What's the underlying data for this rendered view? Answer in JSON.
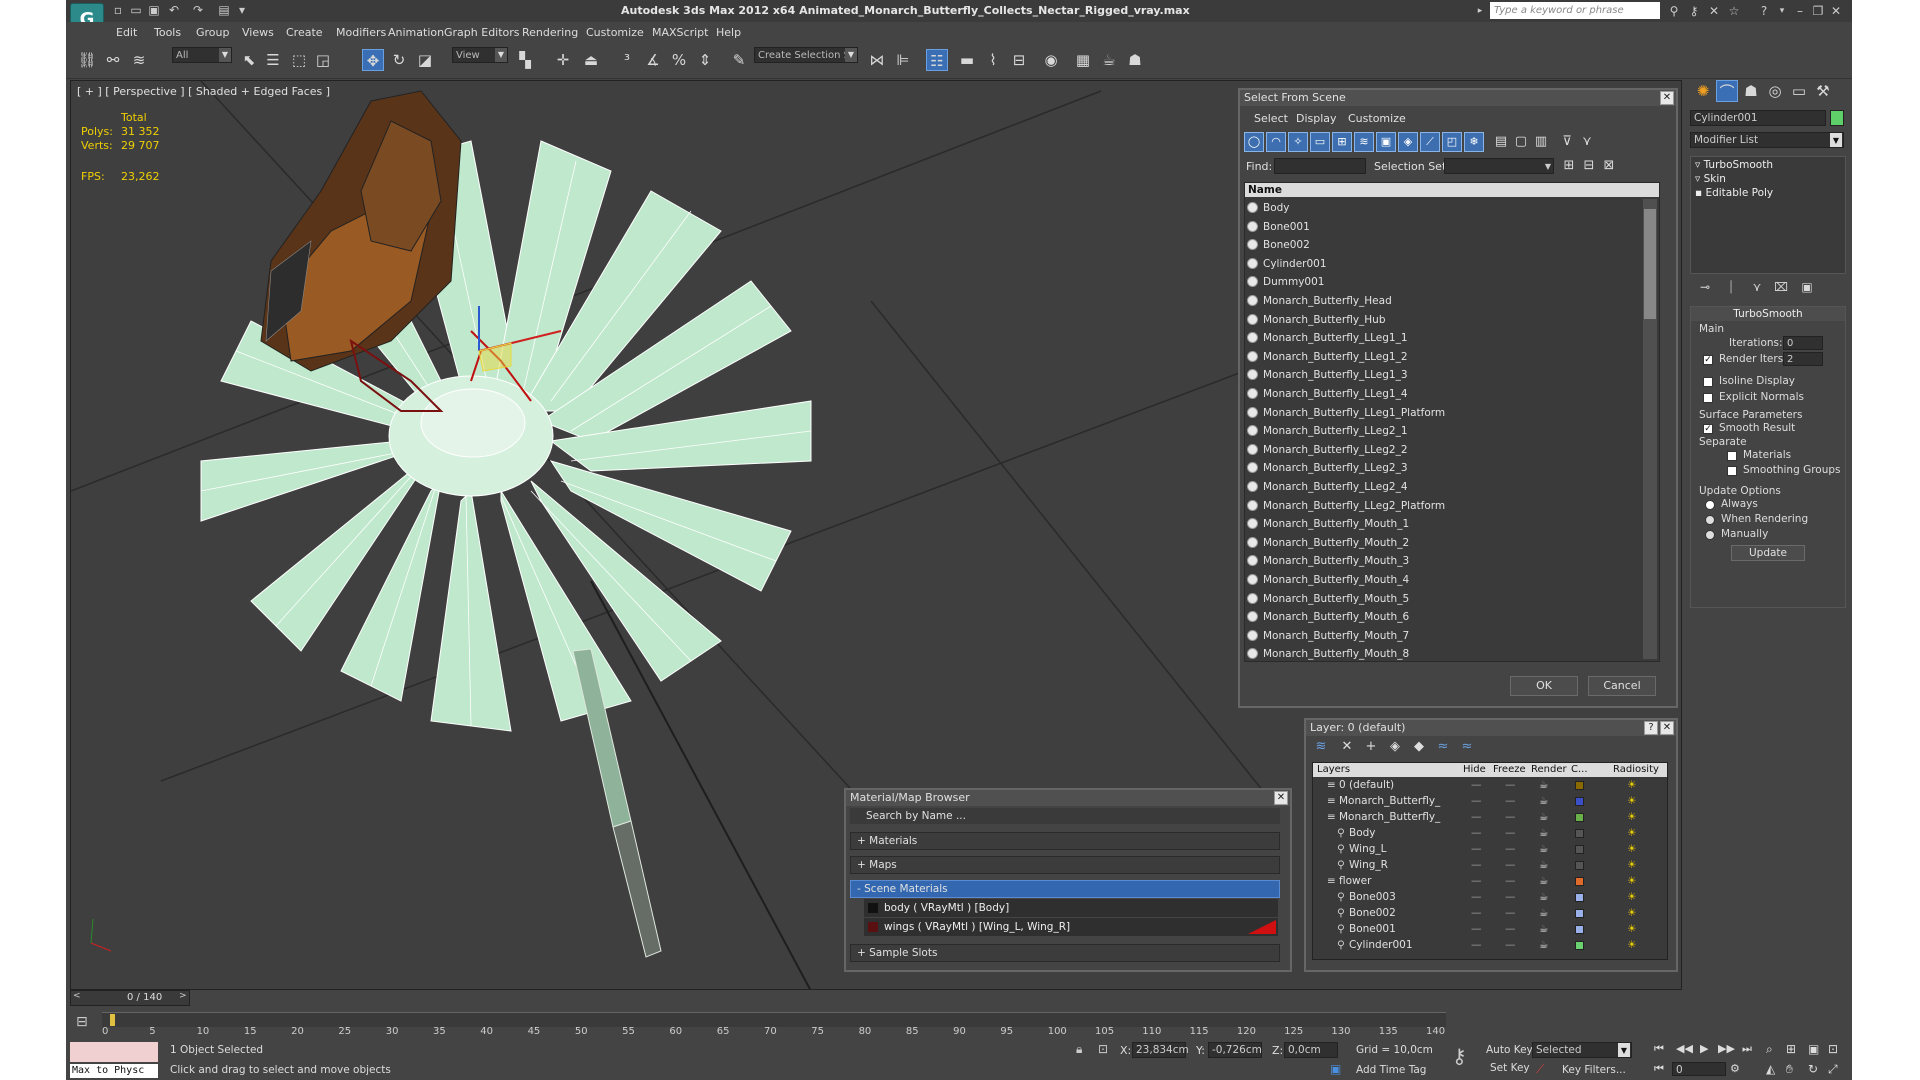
{
  "app": {
    "logo": "G",
    "title": "Autodesk 3ds Max  2012 x64      Animated_Monarch_Butterfly_Collects_Nectar_Rigged_vray.max",
    "search_placeholder": "Type a keyword or phrase"
  },
  "menu": [
    "Edit",
    "Tools",
    "Group",
    "Views",
    "Create",
    "Modifiers",
    "Animation",
    "Graph Editors",
    "Rendering",
    "Customize",
    "MAXScript",
    "Help"
  ],
  "toolbar": {
    "selection_filter": "All",
    "ref_coord": "View",
    "named_selection": "Create Selection Se"
  },
  "viewport": {
    "label": "[ + ] [ Perspective ] [ Shaded + Edged Faces ]",
    "stats": {
      "total_label": "Total",
      "polys_label": "Polys:",
      "polys_value": "31 352",
      "verts_label": "Verts:",
      "verts_value": "29 707",
      "fps_label": "FPS:",
      "fps_value": "23,262"
    }
  },
  "select_from_scene": {
    "title": "Select From Scene",
    "tabs": [
      "Select",
      "Display",
      "Customize"
    ],
    "find_label": "Find:",
    "selection_set_label": "Selection Set:",
    "column_name": "Name",
    "items": [
      "Body",
      "Bone001",
      "Bone002",
      "Cylinder001",
      "Dummy001",
      "Monarch_Butterfly_Head",
      "Monarch_Butterfly_Hub",
      "Monarch_Butterfly_LLeg1_1",
      "Monarch_Butterfly_LLeg1_2",
      "Monarch_Butterfly_LLeg1_3",
      "Monarch_Butterfly_LLeg1_4",
      "Monarch_Butterfly_LLeg1_Platform",
      "Monarch_Butterfly_LLeg2_1",
      "Monarch_Butterfly_LLeg2_2",
      "Monarch_Butterfly_LLeg2_3",
      "Monarch_Butterfly_LLeg2_4",
      "Monarch_Butterfly_LLeg2_Platform",
      "Monarch_Butterfly_Mouth_1",
      "Monarch_Butterfly_Mouth_2",
      "Monarch_Butterfly_Mouth_3",
      "Monarch_Butterfly_Mouth_4",
      "Monarch_Butterfly_Mouth_5",
      "Monarch_Butterfly_Mouth_6",
      "Monarch_Butterfly_Mouth_7",
      "Monarch_Butterfly_Mouth_8"
    ],
    "ok_label": "OK",
    "cancel_label": "Cancel"
  },
  "command_panel": {
    "object_name": "Cylinder001",
    "object_color": "#5fcf6a",
    "modifier_list": "Modifier List",
    "stack": [
      "TurboSmooth",
      "Skin",
      "Editable Poly"
    ],
    "rollout_title": "TurboSmooth",
    "main_label": "Main",
    "iterations_label": "Iterations:",
    "iterations_value": "0",
    "render_iters_label": "Render Iters:",
    "render_iters_value": "2",
    "isoline_label": "Isoline Display",
    "explicit_normals_label": "Explicit Normals",
    "surface_params_label": "Surface Parameters",
    "smooth_result_label": "Smooth Result",
    "separate_label": "Separate",
    "materials_label": "Materials",
    "smoothing_groups_label": "Smoothing Groups",
    "update_options_label": "Update Options",
    "always_label": "Always",
    "when_rendering_label": "When Rendering",
    "manually_label": "Manually",
    "update_button": "Update"
  },
  "material_browser": {
    "title": "Material/Map Browser",
    "search_placeholder": "Search by Name ...",
    "sections": [
      "+ Materials",
      "+ Maps",
      "- Scene Materials",
      "+ Sample Slots"
    ],
    "scene_materials": [
      "body  ( VRayMtl )  [Body]",
      "wings  ( VRayMtl )  [Wing_L, Wing_R]"
    ]
  },
  "layer_manager": {
    "title": "Layer: 0 (default)",
    "columns": [
      "Layers",
      "Hide",
      "Freeze",
      "Render",
      "C...",
      "Radiosity"
    ],
    "rows": [
      {
        "name": "0 (default)",
        "color": "#8a6a00"
      },
      {
        "name": "Monarch_Butterfly_",
        "color": "#3a50c8"
      },
      {
        "name": "Monarch_Butterfly_",
        "color": "#6ab04a"
      },
      {
        "name": "Body",
        "color": "#555555"
      },
      {
        "name": "Wing_L",
        "color": "#555555"
      },
      {
        "name": "Wing_R",
        "color": "#555555"
      },
      {
        "name": "flower",
        "color": "#e06a2a"
      },
      {
        "name": "Bone003",
        "color": "#9ab0e8"
      },
      {
        "name": "Bone002",
        "color": "#9ab0e8"
      },
      {
        "name": "Bone001",
        "color": "#9ab0e8"
      },
      {
        "name": "Cylinder001",
        "color": "#6ad070"
      }
    ]
  },
  "timeline": {
    "frame_label": "0 / 140",
    "ticks": [
      "0",
      "5",
      "10",
      "15",
      "20",
      "25",
      "30",
      "35",
      "40",
      "45",
      "50",
      "55",
      "60",
      "65",
      "70",
      "75",
      "80",
      "85",
      "90",
      "95",
      "100",
      "105",
      "110",
      "115",
      "120",
      "125",
      "130",
      "135",
      "140"
    ]
  },
  "status": {
    "maxscript_label": "Max to Physc",
    "selected_text": "1 Object Selected",
    "prompt_text": "Click and drag to select and move objects",
    "x_label": "X:",
    "x_value": "23,834cm",
    "y_label": "Y:",
    "y_value": "-0,726cm",
    "z_label": "Z:",
    "z_value": "0,0cm",
    "grid_text": "Grid = 10,0cm",
    "add_time_tag": "Add Time Tag",
    "auto_key": "Auto Key",
    "set_key": "Set Key",
    "selected_dropdown": "Selected",
    "key_filters": "Key Filters...",
    "frame_value": "0"
  }
}
